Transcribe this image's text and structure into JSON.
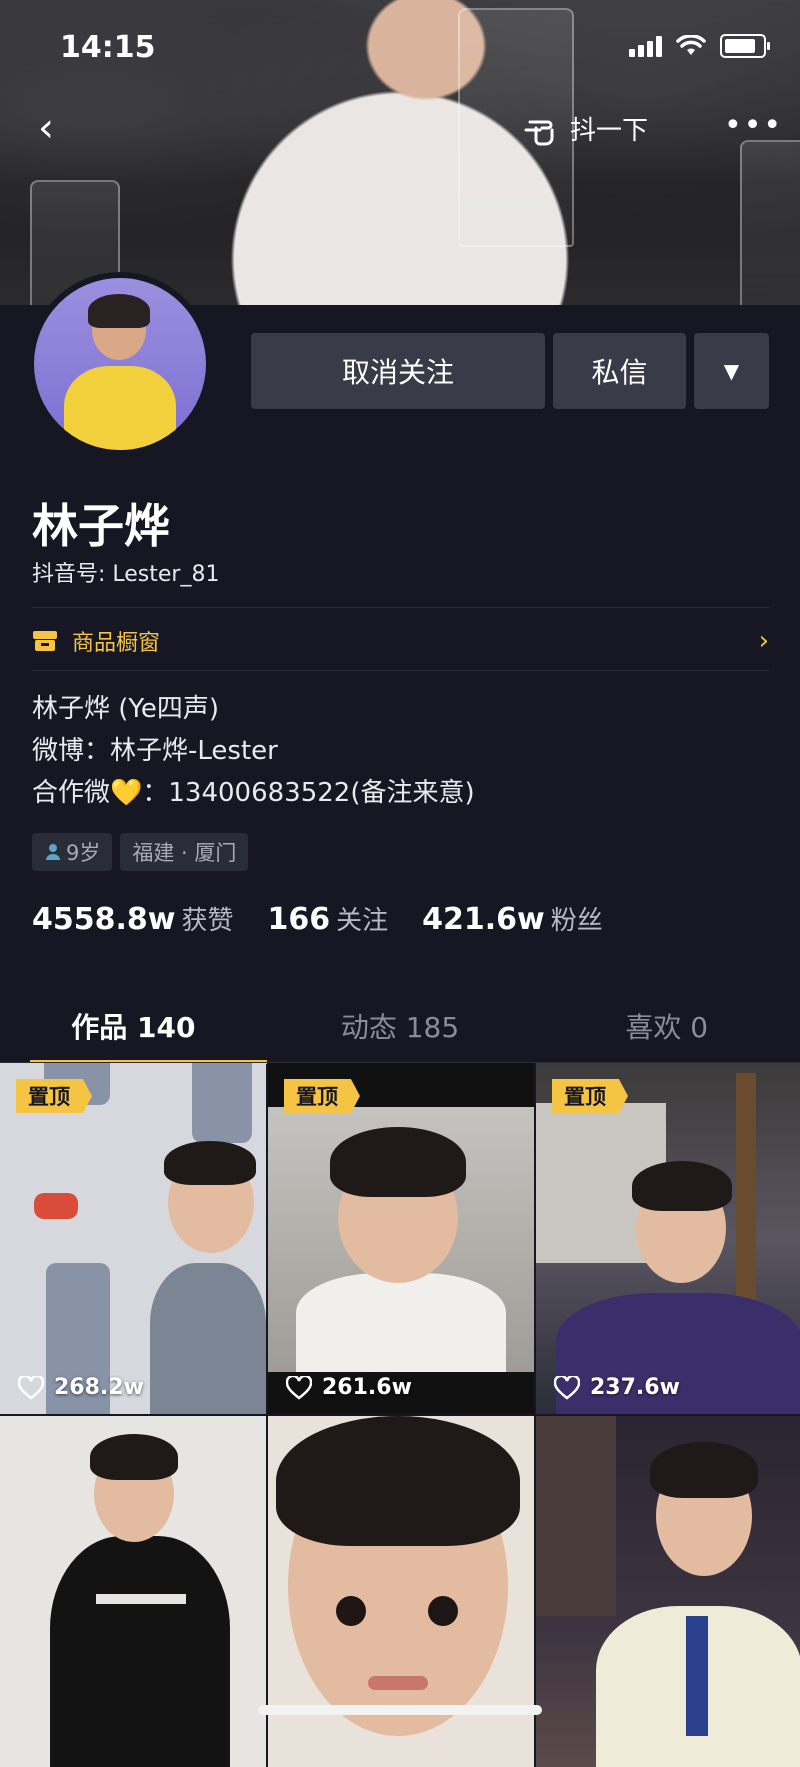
{
  "status_bar": {
    "time": "14:15"
  },
  "nav": {
    "back": "‹",
    "shake_label": "抖一下",
    "more": "•••"
  },
  "actions": {
    "unfollow": "取消关注",
    "message": "私信",
    "dropdown": "▼"
  },
  "profile": {
    "name": "林子烨",
    "douyin_id": "抖音号: Lester_81",
    "shop_label": "商品橱窗",
    "bio": [
      "林子烨 (Ye四声)",
      "微博：林子烨-Lester",
      "合作微💛：13400683522(备注来意)"
    ],
    "tags": {
      "age": "9岁",
      "location": "福建 · 厦门"
    }
  },
  "stats": [
    {
      "num": "4558.8w",
      "label": "获赞"
    },
    {
      "num": "166",
      "label": "关注"
    },
    {
      "num": "421.6w",
      "label": "粉丝"
    }
  ],
  "tabs": [
    {
      "label": "作品 140"
    },
    {
      "label": "动态 185"
    },
    {
      "label": "喜欢 0"
    }
  ],
  "videos": [
    {
      "pinned": "置顶",
      "likes": "268.2w"
    },
    {
      "pinned": "置顶",
      "likes": "261.6w"
    },
    {
      "pinned": "置顶",
      "likes": "237.6w"
    }
  ],
  "colors": {
    "background": "#161723",
    "accent": "#f5c443",
    "button": "#3a3b49"
  }
}
